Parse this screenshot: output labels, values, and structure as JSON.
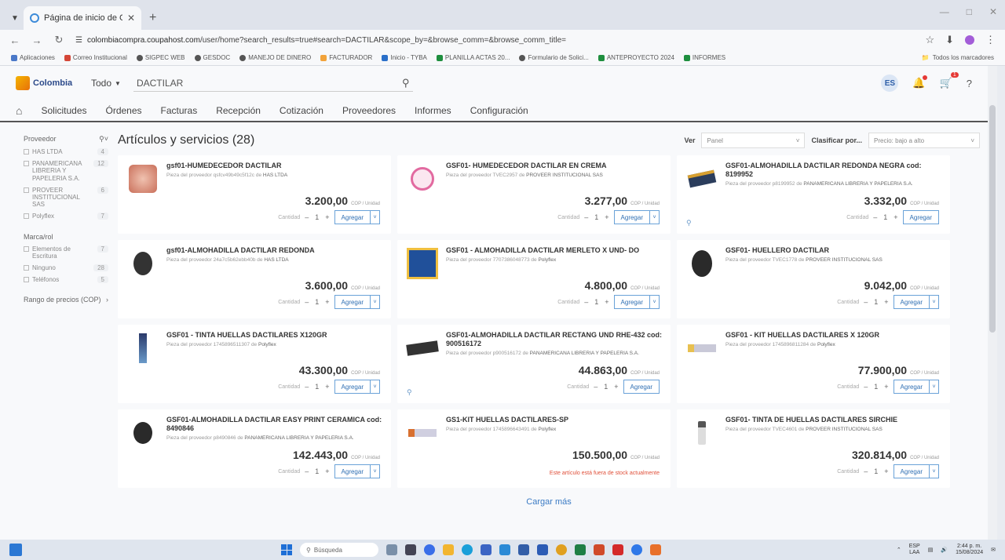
{
  "browser": {
    "tab_title": "Página de inicio de Coupa",
    "url_host": "colombiacompra.coupahost.com",
    "url_path": "/user/home?search_results=true#search=DACTILAR&scope_by=&browse_comm=&browse_comm_title=",
    "bookmarks": [
      {
        "label": "Aplicaciones",
        "color": "#4a78c8"
      },
      {
        "label": "Correo Institucional",
        "color": "#d44638"
      },
      {
        "label": "SIGPEC WEB",
        "color": "#555555"
      },
      {
        "label": "GESDOC",
        "color": "#555555"
      },
      {
        "label": "MANEJO DE DINERO",
        "color": "#555555"
      },
      {
        "label": "FACTURADOR",
        "color": "#f2a33a"
      },
      {
        "label": "Inicio - TYBA",
        "color": "#2a6fc9"
      },
      {
        "label": "PLANILLA ACTAS 20...",
        "color": "#1e8e3e"
      },
      {
        "label": "Formulario de Solici...",
        "color": "#555555"
      },
      {
        "label": "ANTEPROYECTO 2024",
        "color": "#1e8e3e"
      },
      {
        "label": "INFORMES",
        "color": "#1e8e3e"
      }
    ],
    "bookmarks_all": "Todos los marcadores"
  },
  "header": {
    "logo_text": "Colombia",
    "scope": "Todo",
    "search_value": "DACTILAR",
    "avatar": "ES",
    "cart_count": "1"
  },
  "nav": [
    "Solicitudes",
    "Órdenes",
    "Facturas",
    "Recepción",
    "Cotización",
    "Proveedores",
    "Informes",
    "Configuración"
  ],
  "sidebar": {
    "providers_title": "Proveedor",
    "providers": [
      {
        "name": "HAS LTDA",
        "count": "4"
      },
      {
        "name": "PANAMERICANA LIBRERIA Y PAPELERIA S.A.",
        "count": "12"
      },
      {
        "name": "PROVEER INSTITUCIONAL SAS",
        "count": "6"
      },
      {
        "name": "Polyflex",
        "count": "7"
      }
    ],
    "brand_title": "Marca/rol",
    "brands": [
      {
        "name": "Elementos de Escritura",
        "count": "7"
      },
      {
        "name": "Ninguno",
        "count": "28"
      },
      {
        "name": "Teléfonos",
        "count": "5"
      }
    ],
    "price_range": "Rango de precios (COP)"
  },
  "results": {
    "title": "Artículos y servicios (28)",
    "view_label": "Ver",
    "view_value": "Panel",
    "sort_label": "Clasificar por...",
    "sort_value": "Precio: bajo a alto",
    "qty_label": "Cantidad",
    "add_label": "Agregar",
    "unit": "COP / Unidad",
    "load_more": "Cargar más",
    "items": [
      {
        "title": "gsf01-HUMEDECEDOR DACTILAR",
        "sub_prefix": "Pieza del proveedor qsfcv49b49c5f12c de",
        "supplier": "HAS LTDA",
        "price": "3.200,00",
        "icon": "pink-pad-icon"
      },
      {
        "title": "GSF01- HUMEDECEDOR DACTILAR EN CREMA",
        "sub_prefix": "Pieza del proveedor TVEC2957 de",
        "supplier": "PROVEER INSTITUCIONAL SAS",
        "price": "3.277,00",
        "icon": "cream-jar-icon"
      },
      {
        "title": "GSF01-ALMOHADILLA DACTILAR REDONDA NEGRA cod: 8199952",
        "sub_prefix": "Pieza del proveedor p8199952 de",
        "supplier": "PANAMERICANA LIBRERIA Y PAPELERIA S.A.",
        "price": "3.332,00",
        "icon": "ink-pad-icon"
      },
      {
        "title": "gsf01-ALMOHADILLA DACTILAR REDONDA",
        "sub_prefix": "Pieza del proveedor 24a7c5b62ebb40b de",
        "supplier": "HAS LTDA",
        "price": "3.600,00",
        "icon": "round-pad-icon"
      },
      {
        "title": "GSF01 - ALMOHADILLA DACTILAR MERLETO X UND- DO",
        "sub_prefix": "Pieza del proveedor 7707386048773 de",
        "supplier": "Polyflex",
        "price": "4.800,00",
        "icon": "merleto-pad-icon"
      },
      {
        "title": "GSF01- HUELLERO DACTILAR",
        "sub_prefix": "Pieza del proveedor TVEC1778 de",
        "supplier": "PROVEER INSTITUCIONAL SAS",
        "price": "9.042,00",
        "icon": "huellero-icon"
      },
      {
        "title": "GSF01 - TINTA HUELLAS DACTILARES X120GR",
        "sub_prefix": "Pieza del proveedor 1745896511307 de",
        "supplier": "Polyflex",
        "price": "43.300,00",
        "icon": "ink-tube-icon"
      },
      {
        "title": "GSF01-ALMOHADILLA DACTILAR RECTANG UND RHE-432 cod: 900516172",
        "sub_prefix": "Pieza del proveedor p900516172 de",
        "supplier": "PANAMERICANA LIBRERIA Y PAPELERIA S.A.",
        "price": "44.863,00",
        "icon": "rect-pad-icon"
      },
      {
        "title": "GSF01 - KIT HUELLAS DACTILARES X 120GR",
        "sub_prefix": "Pieza del proveedor 1745896811284 de",
        "supplier": "Polyflex",
        "price": "77.900,00",
        "icon": "kit-icon"
      },
      {
        "title": "GSF01-ALMOHADILLA DACTILAR EASY PRINT CERAMICA cod: 8490846",
        "sub_prefix": "Pieza del proveedor p8490846 de",
        "supplier": "PANAMERICANA LIBRERIA Y PAPELERIA S.A.",
        "price": "142.443,00",
        "icon": "ceramic-pad-icon"
      },
      {
        "title": "GS1-KIT HUELLAS DACTILARES-SP",
        "sub_prefix": "Pieza del proveedor 1745896643491 de",
        "supplier": "Polyflex",
        "price": "150.500,00",
        "icon": "kit-sp-icon",
        "out_of_stock": "Este artículo está fuera de stock actualmente"
      },
      {
        "title": "GSF01- TINTA DE HUELLAS DACTILARES SIRCHIE",
        "sub_prefix": "Pieza del proveedor TVEC4601 de",
        "supplier": "PROVEER INSTITUCIONAL SAS",
        "price": "320.814,00",
        "icon": "ink-bottle-icon"
      }
    ]
  },
  "taskbar": {
    "search": "Búsqueda",
    "lang_top": "ESP",
    "lang_bottom": "LAA",
    "time": "2:44 p. m.",
    "date": "15/08/2024"
  }
}
